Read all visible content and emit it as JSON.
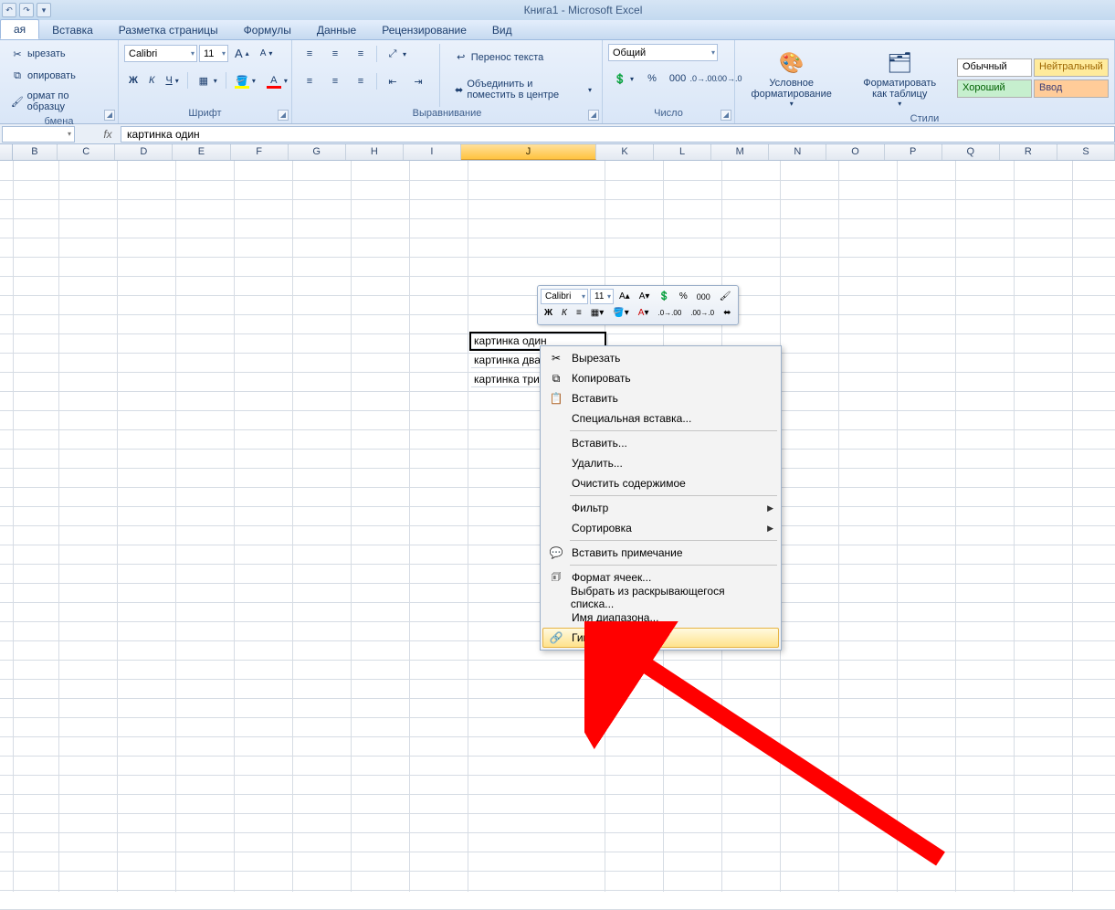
{
  "title": "Книга1 - Microsoft Excel",
  "qat": {
    "undo": "↶",
    "redo": "↷"
  },
  "tabs": [
    "ая",
    "Вставка",
    "Разметка страницы",
    "Формулы",
    "Данные",
    "Рецензирование",
    "Вид"
  ],
  "clipboard": {
    "cut": "ырезать",
    "copy": "опировать",
    "fmtpaint": "ормат по образцу",
    "label": "бмена"
  },
  "font": {
    "name": "Calibri",
    "size": "11",
    "grow": "A",
    "shrink": "A",
    "bold": "Ж",
    "italic": "К",
    "underline": "Ч",
    "label": "Шрифт"
  },
  "align": {
    "wrap": "Перенос текста",
    "merge": "Объединить и поместить в центре",
    "label": "Выравнивание"
  },
  "number": {
    "format": "Общий",
    "label": "Число"
  },
  "styles": {
    "cond": "Условное форматирование",
    "table": "Форматировать как таблицу",
    "normal": "Обычный",
    "neutral": "Нейтральный",
    "good": "Хороший",
    "input": "Ввод",
    "label": "Стили"
  },
  "formula": {
    "fx": "fx",
    "value": "картинка один"
  },
  "columns": [
    "B",
    "C",
    "D",
    "E",
    "F",
    "G",
    "H",
    "I",
    "J",
    "K",
    "L",
    "M",
    "N",
    "O",
    "P",
    "Q",
    "R",
    "S"
  ],
  "sel_col": "J",
  "cells": {
    "J10": "картинка один",
    "J11": "картинка два",
    "J12": "картинка три"
  },
  "mini": {
    "font": "Calibri",
    "size": "11",
    "bold": "Ж",
    "italic": "К"
  },
  "ctx": {
    "cut": "Вырезать",
    "copy": "Копировать",
    "paste": "Вставить",
    "paste_special": "Специальная вставка...",
    "insert": "Вставить...",
    "delete": "Удалить...",
    "clear": "Очистить содержимое",
    "filter": "Фильтр",
    "sort": "Сортировка",
    "comment": "Вставить примечание",
    "format": "Формат ячеек...",
    "picklist": "Выбрать из раскрывающегося списка...",
    "rangename": "Имя диапазона...",
    "hyperlink": "Гиперссылка..."
  }
}
